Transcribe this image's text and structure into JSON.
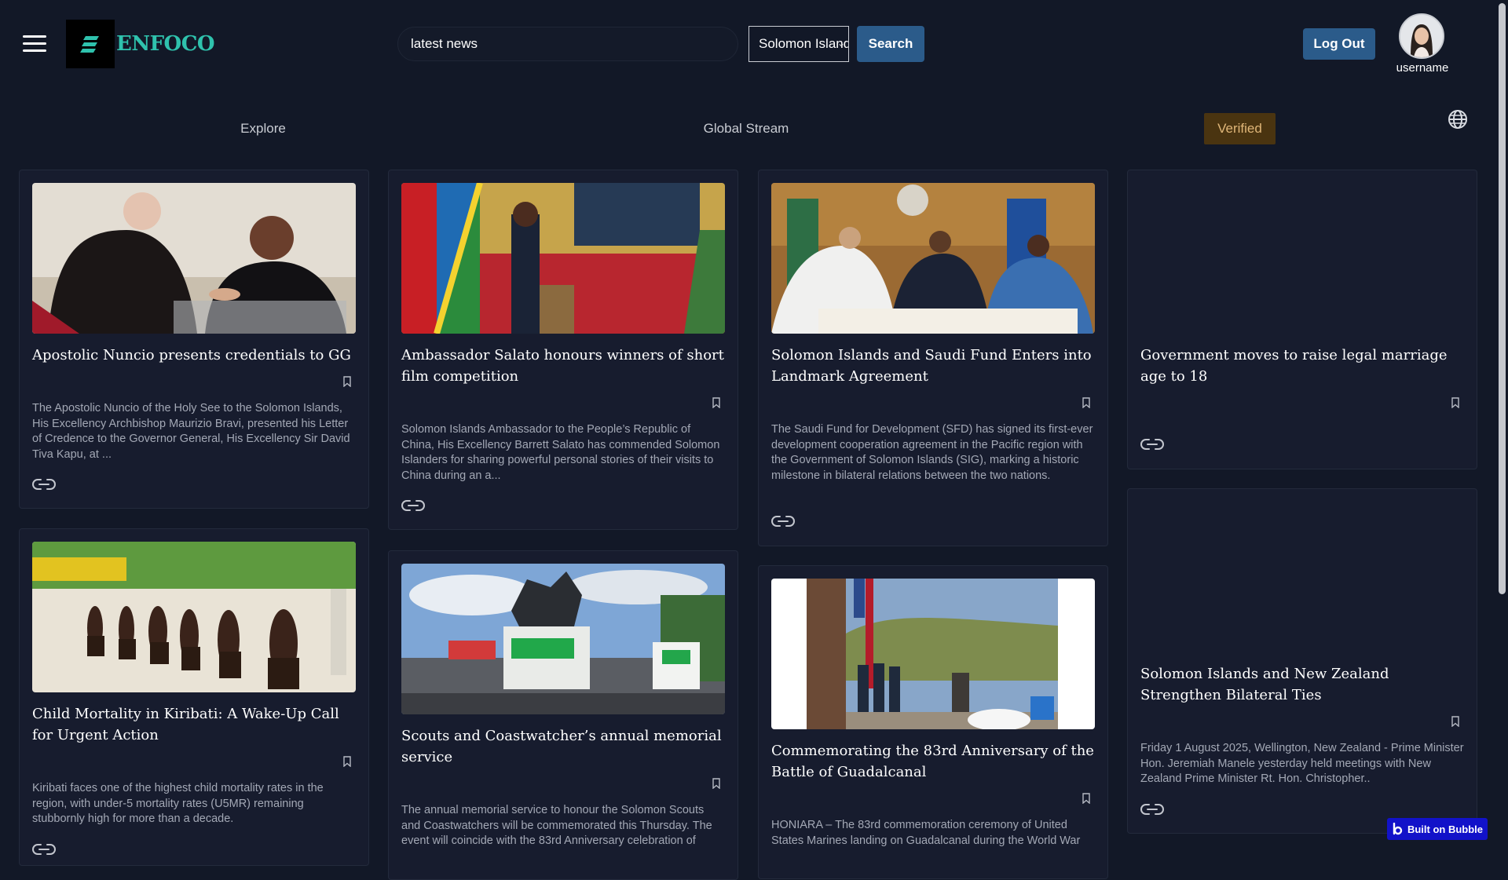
{
  "header": {
    "logo_text": "ENFOCO",
    "search_value": "latest news",
    "country_selected": "Solomon Islands",
    "search_button": "Search",
    "logout_button": "Log Out",
    "username": "username"
  },
  "tabs": {
    "explore": "Explore",
    "global_stream": "Global Stream",
    "verified": "Verified"
  },
  "colors": {
    "background": "#121827",
    "card": "#171c2e",
    "accent_teal": "#2fc2ad",
    "button_blue": "#2b5b8a",
    "verified_bg": "#4a3410"
  },
  "articles": [
    {
      "title": "Apostolic Nuncio presents credentials to GG",
      "description": "The Apostolic Nuncio of the Holy See to the Solomon Islands, His Excellency Archbishop Maurizio Bravi, presented his Letter of Credence to the Governor General, His Excellency Sir David Tiva Kapu, at ..."
    },
    {
      "title": "Ambassador Salato honours winners of short film competition",
      "description": "Solomon Islands Ambassador to the People’s Republic of China, His Excellency Barrett Salato has commended Solomon Islanders for sharing powerful personal stories of their visits to China during an a..."
    },
    {
      "title": "Solomon Islands and Saudi Fund Enters into Landmark Agreement",
      "description": "The Saudi Fund for Development (SFD) has signed its first-ever development cooperation agreement in the Pacific region with the Government of Solomon Islands (SIG), marking a historic milestone in bilateral relations between the two nations."
    },
    {
      "title": "Government moves to raise legal marriage age to 18",
      "description": ""
    },
    {
      "title": "Child Mortality in Kiribati: A Wake-Up Call for Urgent Action",
      "description": "Kiribati faces one of the highest child mortality rates in the region, with under-5 mortality rates (U5MR) remaining stubbornly high for more than a decade."
    },
    {
      "title": "Scouts and Coastwatcher’s annual memorial service",
      "description": "The annual memorial service to honour the Solomon Scouts and Coastwatchers will be commemorated this Thursday. The event will coincide with the 83rd Anniversary celebration of"
    },
    {
      "title": "Commemorating the 83rd Anniversary of the Battle of Guadalcanal",
      "description": "HONIARA – The 83rd commemoration ceremony of United States Marines landing on Guadalcanal during the World War"
    },
    {
      "title": "Solomon Islands and New Zealand Strengthen Bilateral Ties",
      "description": "Friday 1 August 2025, Wellington, New Zealand -  Prime Minister Hon. Jeremiah Manele yesterday held meetings with New Zealand Prime Minister Rt. Hon. Christopher.."
    }
  ],
  "footer": {
    "bubble_badge": "Built on Bubble"
  },
  "icons": [
    "hamburger-icon",
    "globe-icon",
    "bookmark-icon",
    "link-icon",
    "bubble-icon"
  ]
}
